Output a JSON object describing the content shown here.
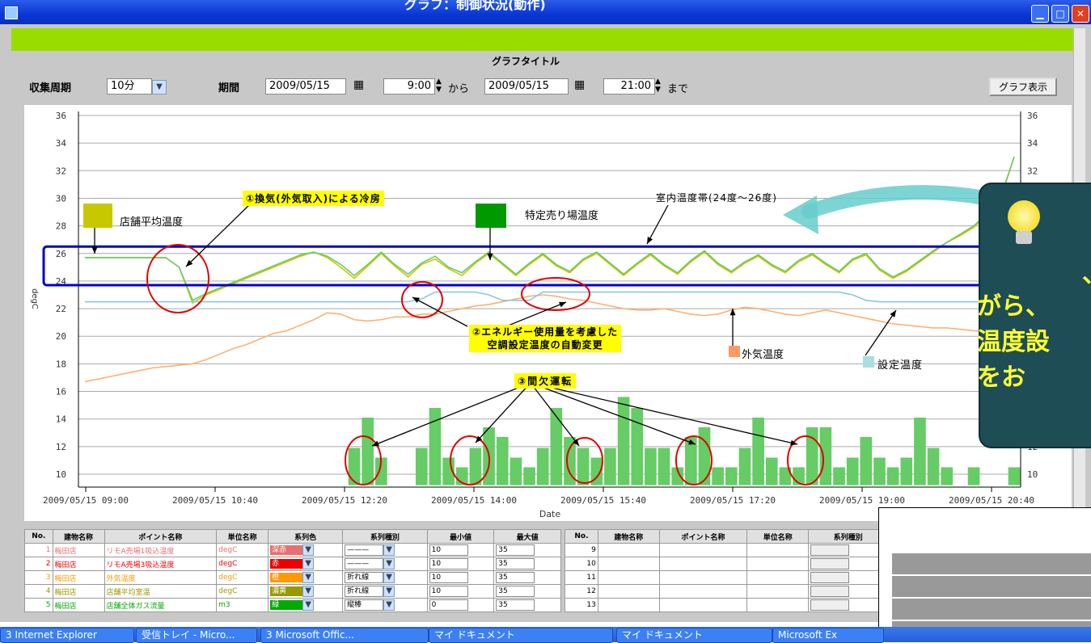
{
  "window": {
    "title": "グラフ：制御状況(動作)"
  },
  "header": {
    "graph_title": "グラフタイトル"
  },
  "controls": {
    "period_label": "収集周期",
    "period_value": "10分",
    "range_label": "期間",
    "start_date": "2009/05/15",
    "start_time": "9:00",
    "from": "から",
    "end_date": "2009/05/15",
    "end_time": "21:00",
    "until": "まで",
    "show_button": "グラフ表示"
  },
  "chart_data": {
    "type": "line",
    "xlabel": "Date",
    "ylabel": "degC",
    "ylim": [
      9,
      36
    ],
    "y_ticks": [
      10,
      12,
      14,
      16,
      18,
      20,
      22,
      24,
      26,
      28,
      30,
      32,
      34,
      36
    ],
    "x_tick_labels": [
      "2009/05/15 09:00",
      "2009/05/15 10:40",
      "2009/05/15 12:20",
      "2009/05/15 14:00",
      "2009/05/15 15:40",
      "2009/05/15 17:20",
      "2009/05/15 19:00",
      "2009/05/15 20:40"
    ],
    "band": {
      "min": 24,
      "max": 26
    },
    "series": [
      {
        "name": "店舗平均温度",
        "color": "#c8c800",
        "values": [
          25.7,
          25.7,
          25.7,
          25.7,
          25.7,
          25.7,
          25.7,
          25.0,
          22.4,
          23.0,
          23.4,
          23.8,
          24.2,
          24.6,
          25.0,
          25.4,
          25.8,
          26.1,
          25.7,
          25.0,
          24.2,
          25.1,
          26.0,
          25.1,
          24.3,
          25.2,
          25.6,
          24.9,
          24.4,
          25.3,
          26.0,
          25.2,
          24.4,
          25.2,
          25.9,
          25.1,
          24.6,
          25.5,
          26.0,
          25.2,
          24.4,
          25.2,
          25.9,
          25.1,
          24.5,
          25.4,
          26.1,
          25.2,
          24.6,
          25.3,
          25.8,
          25.1,
          24.6,
          25.4,
          25.9,
          25.2,
          24.6,
          25.5,
          25.9,
          24.8,
          24.2,
          24.7,
          25.4,
          26.1,
          26.8,
          27.3,
          27.9,
          28.8,
          30.0,
          33.0
        ]
      },
      {
        "name": "特定売り場温度",
        "color": "#66cc66",
        "values": [
          25.7,
          25.7,
          25.7,
          25.7,
          25.7,
          25.7,
          25.7,
          25.0,
          22.6,
          23.1,
          23.5,
          23.9,
          24.3,
          24.7,
          25.1,
          25.5,
          25.9,
          26.1,
          25.8,
          25.2,
          24.4,
          25.2,
          26.1,
          25.2,
          24.5,
          25.3,
          25.8,
          25.0,
          24.6,
          25.4,
          26.1,
          25.3,
          24.5,
          25.3,
          26.0,
          25.2,
          24.7,
          25.6,
          26.1,
          25.3,
          24.5,
          25.3,
          26.0,
          25.2,
          24.6,
          25.5,
          26.2,
          25.3,
          24.7,
          25.4,
          25.9,
          25.2,
          24.7,
          25.5,
          26.0,
          25.3,
          24.7,
          25.6,
          26.0,
          24.9,
          24.3,
          24.8,
          25.5,
          26.2,
          26.8,
          27.4,
          28.0,
          28.9,
          30.1,
          33.0
        ]
      },
      {
        "name": "外気温度",
        "color": "#ffb070",
        "values": [
          16.7,
          16.9,
          17.1,
          17.3,
          17.5,
          17.7,
          17.8,
          17.9,
          18.0,
          18.3,
          18.7,
          19.1,
          19.4,
          19.8,
          20.2,
          20.4,
          20.8,
          21.2,
          21.7,
          21.6,
          21.2,
          21.1,
          21.2,
          21.4,
          21.4,
          21.6,
          21.6,
          21.8,
          22.0,
          22.2,
          22.3,
          22.5,
          22.7,
          22.9,
          23.0,
          22.9,
          22.7,
          22.6,
          22.4,
          22.2,
          22.0,
          21.9,
          21.9,
          22.0,
          21.8,
          21.6,
          21.5,
          21.6,
          21.9,
          22.1,
          22.0,
          21.8,
          21.6,
          21.5,
          21.7,
          21.9,
          21.7,
          21.5,
          21.3,
          21.1,
          20.9,
          20.8,
          20.7,
          20.6,
          20.6,
          20.5,
          20.4,
          20.3,
          20.1,
          20.0
        ]
      },
      {
        "name": "設定温度",
        "color": "#88c8e8",
        "values": [
          22.5,
          22.5,
          22.5,
          22.5,
          22.5,
          22.5,
          22.5,
          22.5,
          22.5,
          22.5,
          22.5,
          22.5,
          22.5,
          22.5,
          22.5,
          22.5,
          22.5,
          22.5,
          22.5,
          22.5,
          22.5,
          22.5,
          22.5,
          22.5,
          22.5,
          22.7,
          23.2,
          23.2,
          23.2,
          23.2,
          23.0,
          22.6,
          22.6,
          22.6,
          23.2,
          23.2,
          23.2,
          23.2,
          23.2,
          23.2,
          23.2,
          23.2,
          23.2,
          23.2,
          23.2,
          23.2,
          23.2,
          23.2,
          23.2,
          23.2,
          23.2,
          23.2,
          23.2,
          23.2,
          23.2,
          23.2,
          23.2,
          23.0,
          22.6,
          22.5,
          22.5,
          22.5,
          22.5,
          22.5,
          22.5,
          22.5,
          22.5,
          22.5,
          22.5,
          22.5
        ]
      }
    ],
    "bars": {
      "name": "店舗全体ガス流量",
      "color": "#66cc66",
      "values": [
        0,
        0,
        0,
        0,
        0,
        0,
        0,
        0,
        0,
        0,
        0,
        0,
        0,
        0,
        0,
        0,
        0,
        0,
        0,
        0,
        11.9,
        14.1,
        11.2,
        0,
        0,
        11.9,
        14.8,
        11.2,
        10.5,
        11.9,
        13.4,
        12.7,
        11.2,
        10.5,
        11.9,
        14.8,
        12.7,
        11.9,
        11.2,
        11.9,
        15.6,
        14.8,
        11.9,
        11.9,
        10.5,
        12.7,
        13.4,
        10.5,
        10.5,
        11.9,
        14.1,
        11.2,
        10.5,
        10.5,
        13.4,
        13.4,
        10.5,
        11.2,
        12.7,
        11.2,
        10.5,
        11.2,
        14.1,
        11.9,
        10.5,
        0,
        10.5,
        0,
        0,
        10.5
      ]
    }
  },
  "annotations": {
    "ventilation": "①換気(外気取入)による冷房",
    "energy_line1": "②エネルギー使用量を考慮した",
    "energy_line2": "空調設定温度の自動変更",
    "intermittent": "③間欠運転",
    "band_label": "室内温度帯(24度～26度)",
    "legend_store_avg": "店舗平均温度",
    "legend_specific": "特定売り場温度",
    "legend_outside": "外気温度",
    "legend_setpoint": "設定温度",
    "callout_line1": "、",
    "callout_line2": "がら、",
    "callout_line3": "温度設",
    "callout_line4": "をお"
  },
  "table_left": {
    "headers": [
      "No.",
      "建物名称",
      "ポイント名称",
      "単位名称",
      "系列色",
      "系列種別",
      "最小値",
      "最大値"
    ],
    "rows": [
      {
        "no": "1",
        "building": "梅田店",
        "point": "リモA売場1吸込温度",
        "unit": "degC",
        "color_name": "深赤",
        "color": "#e87070",
        "type": "———",
        "min": "10",
        "max": "35"
      },
      {
        "no": "2",
        "building": "梅田店",
        "point": "リモA売場3吸込温度",
        "unit": "degC",
        "color_name": "赤",
        "color": "#ee0000",
        "type": "———",
        "min": "10",
        "max": "35"
      },
      {
        "no": "3",
        "building": "梅田店",
        "point": "外気温度",
        "unit": "degC",
        "color_name": "橙",
        "color": "#ff9900",
        "type": "折れ線",
        "min": "10",
        "max": "35"
      },
      {
        "no": "4",
        "building": "梅田店",
        "point": "店舗平均室温",
        "unit": "degC",
        "color_name": "濃黄",
        "color": "#999900",
        "type": "折れ線",
        "min": "10",
        "max": "35"
      },
      {
        "no": "5",
        "building": "梅田店",
        "point": "店舗全体ガス流量",
        "unit": "m3",
        "color_name": "緑",
        "color": "#00aa00",
        "type": "縦棒",
        "min": "0",
        "max": "35"
      }
    ]
  },
  "table_right": {
    "headers": [
      "No.",
      "建物名称",
      "ポイント名称",
      "単位名称",
      "系列種別"
    ],
    "rows": [
      "9",
      "10",
      "11",
      "12",
      "13"
    ]
  },
  "taskbar": {
    "items": [
      "3 Internet Explorer",
      "受信トレイ - Micro...",
      "3 Microsoft Offic...",
      "マイ ドキュメント",
      "マイ ドキュメント",
      "Microsoft Ex"
    ]
  }
}
